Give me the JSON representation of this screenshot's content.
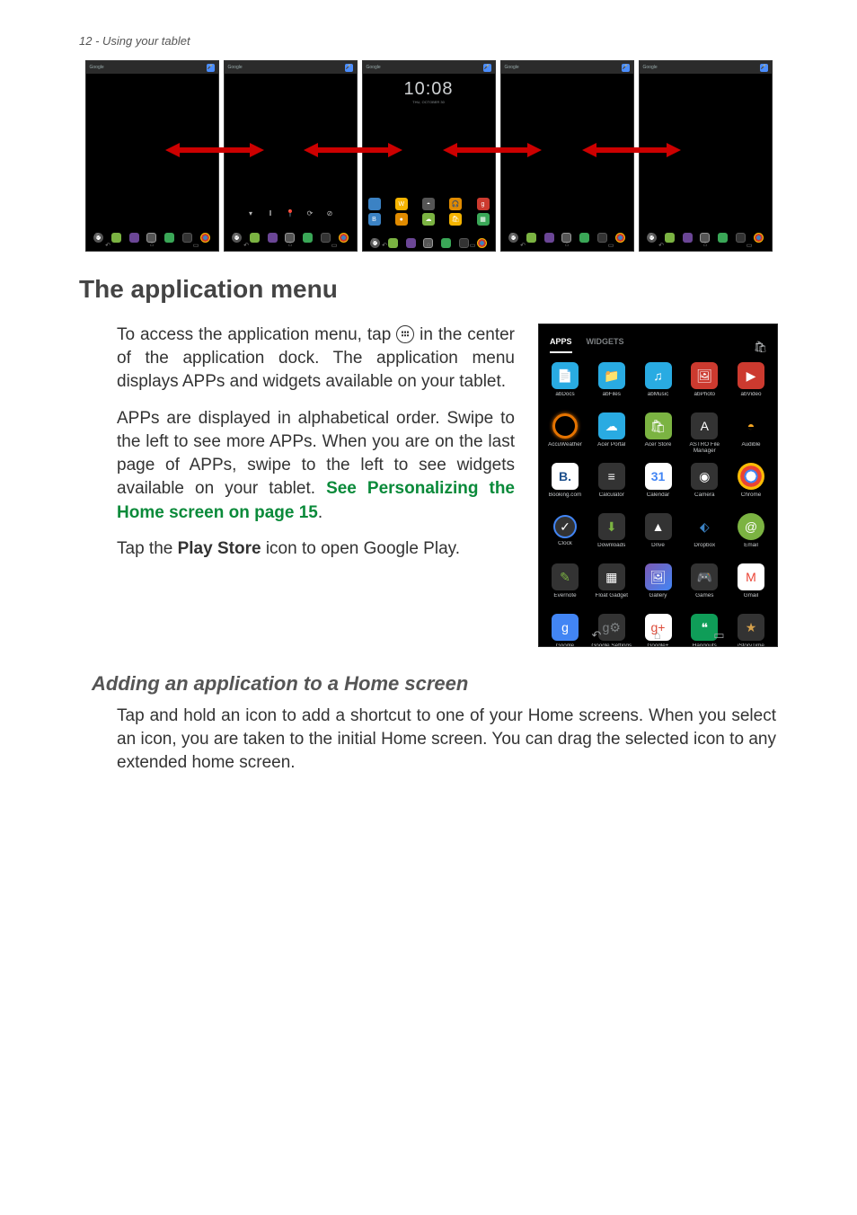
{
  "header": "12 - Using your tablet",
  "section_title": "The application menu",
  "para1_a": "To access the application menu, tap ",
  "para1_b": " in the center of the application dock. The application menu displays APPs and widgets available on your tablet.",
  "para2": "APPs are displayed in alphabetical order. Swipe to the left to see more APPs. When you are on the last page of APPs, swipe to the left to see widgets available on your tablet. ",
  "para2_link": "See Personalizing the Home screen on page 15",
  "para2_end": ".",
  "para3_a": "Tap the ",
  "para3_bold": "Play Store",
  "para3_b": " icon to open Google Play.",
  "subsection_title": "Adding an application to a Home screen",
  "para4": "Tap and hold an icon to add a shortcut to one of your Home screens. When you select an icon, you are taken to the initial Home screen. You can drag the selected icon to any extended home screen.",
  "clock_time": "10:08",
  "clock_date": "THU, OCTOBER 30",
  "search_label": "Google",
  "tabs": {
    "apps": "APPS",
    "widgets": "WIDGETS"
  },
  "apps": [
    [
      {
        "label": "abDocs",
        "cls": "ic-doc",
        "glyph": "📄"
      },
      {
        "label": "abFiles",
        "cls": "ic-files",
        "glyph": "📁"
      },
      {
        "label": "abMusic",
        "cls": "ic-music",
        "glyph": "♫"
      },
      {
        "label": "abPhoto",
        "cls": "ic-photo",
        "glyph": "🖼"
      },
      {
        "label": "abVideo",
        "cls": "ic-video",
        "glyph": "▶"
      }
    ],
    [
      {
        "label": "AccuWeather",
        "cls": "ic-accu",
        "glyph": ""
      },
      {
        "label": "Acer Portal",
        "cls": "ic-portal",
        "glyph": "☁"
      },
      {
        "label": "Acer Store",
        "cls": "ic-store",
        "glyph": "🛍"
      },
      {
        "label": "ASTRO File Manager",
        "cls": "ic-astro",
        "glyph": "A"
      },
      {
        "label": "Audible",
        "cls": "ic-audible",
        "glyph": "◓"
      }
    ],
    [
      {
        "label": "Booking.com",
        "cls": "ic-booking",
        "glyph": "B."
      },
      {
        "label": "Calculator",
        "cls": "ic-calc",
        "glyph": "≡"
      },
      {
        "label": "Calendar",
        "cls": "ic-calendar",
        "glyph": "31"
      },
      {
        "label": "Camera",
        "cls": "ic-camera",
        "glyph": "◉"
      },
      {
        "label": "Chrome",
        "cls": "ic-chrome",
        "glyph": ""
      }
    ],
    [
      {
        "label": "Clock",
        "cls": "ic-clock",
        "glyph": "✓"
      },
      {
        "label": "Downloads",
        "cls": "ic-downloads",
        "glyph": "⬇"
      },
      {
        "label": "Drive",
        "cls": "ic-drive",
        "glyph": "▲"
      },
      {
        "label": "Dropbox",
        "cls": "ic-dropbox",
        "glyph": "⬖"
      },
      {
        "label": "Email",
        "cls": "ic-email",
        "glyph": "@"
      }
    ],
    [
      {
        "label": "Evernote",
        "cls": "ic-evernote",
        "glyph": "✎"
      },
      {
        "label": "Float Gadget",
        "cls": "ic-float",
        "glyph": "▦"
      },
      {
        "label": "Gallery",
        "cls": "ic-gallery",
        "glyph": "🖼"
      },
      {
        "label": "Games",
        "cls": "ic-games",
        "glyph": "🎮"
      },
      {
        "label": "Gmail",
        "cls": "ic-gmail",
        "glyph": "M"
      }
    ],
    [
      {
        "label": "Google",
        "cls": "ic-google",
        "glyph": "g"
      },
      {
        "label": "Google Settings",
        "cls": "ic-gsettings",
        "glyph": "g⚙"
      },
      {
        "label": "Google+",
        "cls": "ic-gplus",
        "glyph": "g+"
      },
      {
        "label": "Hangouts",
        "cls": "ic-hangouts",
        "glyph": "❝"
      },
      {
        "label": "iStoryTime",
        "cls": "ic-istory",
        "glyph": "★"
      }
    ]
  ]
}
